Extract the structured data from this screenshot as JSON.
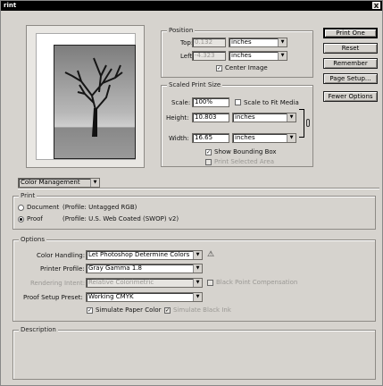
{
  "window": {
    "title": "rint",
    "close_label": "X"
  },
  "position": {
    "legend": "Position",
    "top_label": "Top:",
    "top_value": "0.132",
    "top_unit": "inches",
    "left_label": "Left:",
    "left_value": "-4.323",
    "left_unit": "inches",
    "center_image_label": "Center Image",
    "center_image_checked": true
  },
  "scaled": {
    "legend": "Scaled Print Size",
    "scale_label": "Scale:",
    "scale_value": "100%",
    "scale_to_fit_label": "Scale to Fit Media",
    "height_label": "Height:",
    "height_value": "10.803",
    "height_unit": "inches",
    "width_label": "Width:",
    "width_value": "16.65",
    "width_unit": "inches",
    "show_bounding_label": "Show Bounding Box",
    "show_bounding_checked": true,
    "print_selected_label": "Print Selected Area"
  },
  "buttons": {
    "print_one": "Print One",
    "reset": "Reset",
    "remember": "Remember",
    "page_setup": "Page Setup...",
    "fewer_options": "Fewer Options"
  },
  "color_management": {
    "value": "Color Management"
  },
  "print_group": {
    "legend": "Print",
    "document_label": "Document",
    "document_profile": "(Profile: Untagged RGB)",
    "proof_label": "Proof",
    "proof_profile": "(Profile: U.S. Web Coated (SWOP) v2)",
    "selected": "proof"
  },
  "options": {
    "legend": "Options",
    "color_handling_label": "Color Handling:",
    "color_handling_value": "Let Photoshop Determine Colors",
    "printer_profile_label": "Printer Profile:",
    "printer_profile_value": "Gray Gamma 1.8",
    "rendering_intent_label": "Rendering Intent:",
    "rendering_intent_value": "Relative Colorimetric",
    "black_point_label": "Black Point Compensation",
    "proof_setup_label": "Proof Setup Preset:",
    "proof_setup_value": "Working CMYK",
    "simulate_paper_label": "Simulate Paper Color",
    "simulate_paper_checked": true,
    "simulate_ink_label": "Simulate Black Ink",
    "simulate_ink_checked": true
  },
  "description": {
    "legend": "Description"
  }
}
